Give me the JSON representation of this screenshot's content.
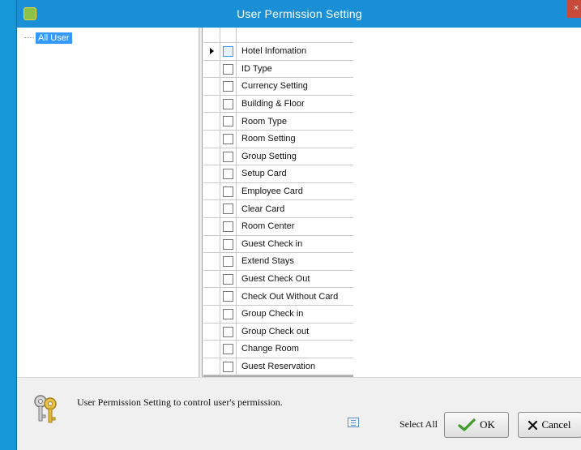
{
  "window": {
    "title": "User Permission Setting",
    "close_glyph": "×"
  },
  "tree": {
    "root_label": "All User"
  },
  "permissions": [
    {
      "label": "Hotel Infomation",
      "checked": false,
      "current": true
    },
    {
      "label": "ID Type",
      "checked": false
    },
    {
      "label": "Currency Setting",
      "checked": false
    },
    {
      "label": "Building & Floor",
      "checked": false
    },
    {
      "label": "Room Type",
      "checked": false
    },
    {
      "label": "Room Setting",
      "checked": false
    },
    {
      "label": "Group Setting",
      "checked": false
    },
    {
      "label": "Setup Card",
      "checked": false
    },
    {
      "label": "Employee Card",
      "checked": false
    },
    {
      "label": "Clear Card",
      "checked": false
    },
    {
      "label": "Room Center",
      "checked": false
    },
    {
      "label": "Guest Check in",
      "checked": false
    },
    {
      "label": "Extend Stays",
      "checked": false
    },
    {
      "label": "Guest Check Out",
      "checked": false
    },
    {
      "label": "Check Out Without Card",
      "checked": false
    },
    {
      "label": "Group Check in",
      "checked": false
    },
    {
      "label": "Group Check out",
      "checked": false
    },
    {
      "label": "Change Room",
      "checked": false
    },
    {
      "label": "Guest Reservation",
      "checked": false
    }
  ],
  "footer": {
    "message": "User Permission Setting to control user's permission.",
    "select_all_label": "Select All",
    "ok_label": "OK",
    "cancel_label": "Cancel"
  },
  "icons": {
    "app": "app-icon",
    "keys": "keys-icon",
    "grid": "grid-icon",
    "ok": "checkmark-icon",
    "cancel": "x-icon"
  },
  "colors": {
    "titlebar": "#1a8fd6",
    "selection": "#3399ff",
    "close": "#c74a3a"
  }
}
